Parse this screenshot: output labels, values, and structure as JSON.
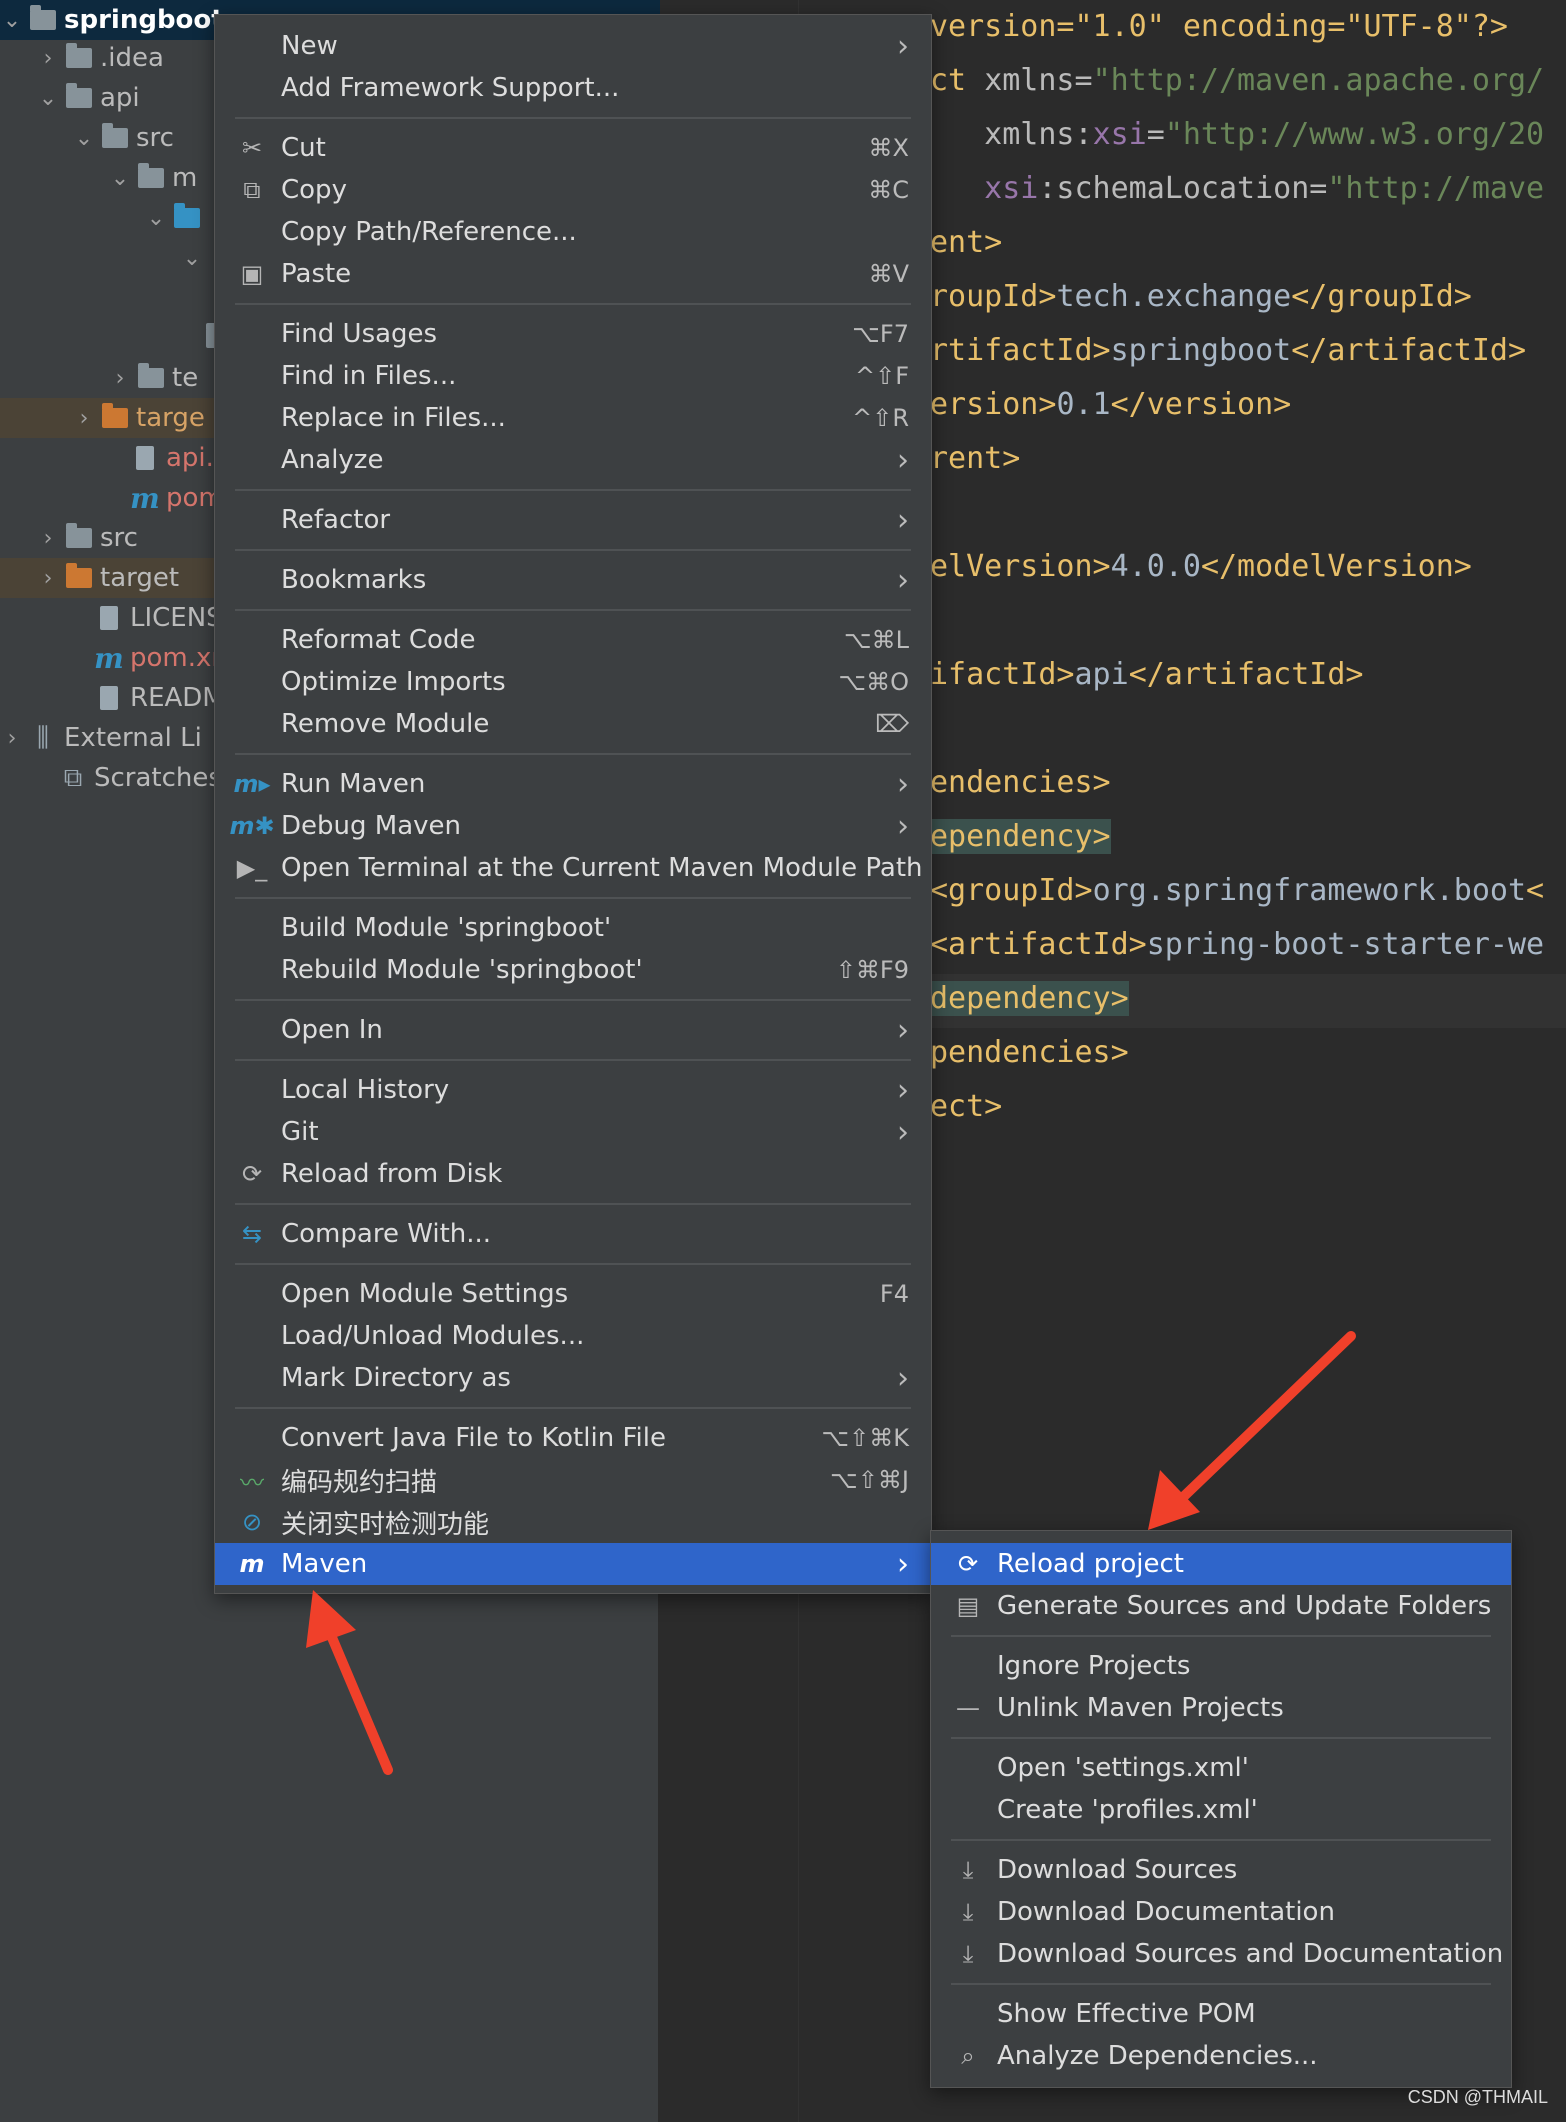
{
  "project_tree": {
    "rows": [
      {
        "label": "springboot",
        "chev": "⌄",
        "icon": "module-folder-icon"
      },
      {
        "label": ".idea",
        "chev": "›",
        "icon": "folder-icon"
      },
      {
        "label": "api",
        "chev": "⌄",
        "icon": "module-folder-icon"
      },
      {
        "label": "src",
        "chev": "⌄",
        "icon": "folder-icon"
      },
      {
        "label": "m",
        "chev": "⌄",
        "icon": "folder-icon"
      },
      {
        "label": "",
        "chev": "⌄",
        "icon": "blue-folder-icon"
      },
      {
        "label": "",
        "chev": "⌄",
        "icon": ""
      },
      {
        "label": "",
        "chev": "",
        "icon": "folder-icon"
      },
      {
        "label": "te",
        "chev": "›",
        "icon": "folder-icon"
      },
      {
        "label": "targe",
        "chev": "›",
        "icon": "orange-folder-icon"
      },
      {
        "label": "api.ir",
        "chev": "",
        "icon": "file-icon"
      },
      {
        "label": "pom.",
        "chev": "",
        "icon": "maven-icon"
      },
      {
        "label": "src",
        "chev": "›",
        "icon": "folder-icon"
      },
      {
        "label": "target",
        "chev": "›",
        "icon": "orange-folder-icon"
      },
      {
        "label": "LICENSE",
        "chev": "",
        "icon": "file-icon"
      },
      {
        "label": "pom.xm",
        "chev": "",
        "icon": "maven-icon"
      },
      {
        "label": "README",
        "chev": "",
        "icon": "file-icon"
      },
      {
        "label": "External Li",
        "chev": "›",
        "icon": "library-icon"
      },
      {
        "label": "Scratches a",
        "chev": "",
        "icon": "scratches-icon"
      }
    ]
  },
  "editor": {
    "lines": [
      {
        "parts": [
          [
            "pi",
            "version=\"1.0\" encoding=\"UTF-8\"?>"
          ]
        ]
      },
      {
        "parts": [
          [
            "tag",
            "ct "
          ],
          [
            "attr",
            "xmlns="
          ],
          [
            "val",
            "\"http://maven.apache.org/"
          ]
        ]
      },
      {
        "parts": [
          [
            "attr",
            "   xmlns:"
          ],
          [
            "ns",
            "xsi"
          ],
          [
            "attr",
            "="
          ],
          [
            "val",
            "\"http://www.w3.org/20"
          ]
        ]
      },
      {
        "parts": [
          [
            "ns",
            "   xsi"
          ],
          [
            "attr",
            ":schemaLocation="
          ],
          [
            "val",
            "\"http://mave"
          ]
        ]
      },
      {
        "parts": [
          [
            "tag",
            "ent>"
          ]
        ]
      },
      {
        "parts": [
          [
            "tag",
            "roupId>"
          ],
          [
            "text",
            "tech.exchange"
          ],
          [
            "tag",
            "</groupId>"
          ]
        ]
      },
      {
        "parts": [
          [
            "tag",
            "rtifactId>"
          ],
          [
            "text",
            "springboot"
          ],
          [
            "tag",
            "</artifactId>"
          ]
        ]
      },
      {
        "parts": [
          [
            "tag",
            "ersion>"
          ],
          [
            "text",
            "0.1"
          ],
          [
            "tag",
            "</version>"
          ]
        ]
      },
      {
        "parts": [
          [
            "tag",
            "rent>"
          ]
        ]
      },
      {
        "parts": []
      },
      {
        "parts": [
          [
            "tag",
            "elVersion>"
          ],
          [
            "text",
            "4.0.0"
          ],
          [
            "tag",
            "</modelVersion>"
          ]
        ]
      },
      {
        "parts": []
      },
      {
        "parts": [
          [
            "tag",
            "ifactId>"
          ],
          [
            "text",
            "api"
          ],
          [
            "tag",
            "</artifactId>"
          ]
        ]
      },
      {
        "parts": []
      },
      {
        "parts": [
          [
            "tag",
            "endencies>"
          ]
        ]
      },
      {
        "parts": [
          [
            "match",
            "ependency>"
          ]
        ]
      },
      {
        "parts": [
          [
            "tag",
            "<groupId>"
          ],
          [
            "text",
            "org.springframework.boot"
          ],
          [
            "tag",
            "<"
          ]
        ]
      },
      {
        "parts": [
          [
            "tag",
            "<artifactId>"
          ],
          [
            "text",
            "spring-boot-starter-we"
          ]
        ]
      },
      {
        "parts": [
          [
            "match",
            "dependency>"
          ]
        ]
      },
      {
        "parts": [
          [
            "tag",
            "pendencies>"
          ]
        ]
      },
      {
        "parts": [
          [
            "tag",
            "ect>"
          ]
        ]
      }
    ]
  },
  "context_menu": {
    "items": [
      {
        "label": "New",
        "shortcut": "",
        "submenu": true,
        "icon": ""
      },
      {
        "label": "Add Framework Support...",
        "shortcut": "",
        "submenu": false,
        "icon": ""
      },
      {
        "sep": true
      },
      {
        "label": "Cut",
        "shortcut": "⌘X",
        "submenu": false,
        "icon": "scissors-icon"
      },
      {
        "label": "Copy",
        "shortcut": "⌘C",
        "submenu": false,
        "icon": "copy-icon"
      },
      {
        "label": "Copy Path/Reference...",
        "shortcut": "",
        "submenu": false,
        "icon": ""
      },
      {
        "label": "Paste",
        "shortcut": "⌘V",
        "submenu": false,
        "icon": "paste-icon"
      },
      {
        "sep": true
      },
      {
        "label": "Find Usages",
        "shortcut": "⌥F7",
        "submenu": false,
        "icon": ""
      },
      {
        "label": "Find in Files...",
        "shortcut": "^⇧F",
        "submenu": false,
        "icon": ""
      },
      {
        "label": "Replace in Files...",
        "shortcut": "^⇧R",
        "submenu": false,
        "icon": ""
      },
      {
        "label": "Analyze",
        "shortcut": "",
        "submenu": true,
        "icon": ""
      },
      {
        "sep": true
      },
      {
        "label": "Refactor",
        "shortcut": "",
        "submenu": true,
        "icon": ""
      },
      {
        "sep": true
      },
      {
        "label": "Bookmarks",
        "shortcut": "",
        "submenu": true,
        "icon": ""
      },
      {
        "sep": true
      },
      {
        "label": "Reformat Code",
        "shortcut": "⌥⌘L",
        "submenu": false,
        "icon": ""
      },
      {
        "label": "Optimize Imports",
        "shortcut": "⌥⌘O",
        "submenu": false,
        "icon": ""
      },
      {
        "label": "Remove Module",
        "shortcut": "⌦",
        "submenu": false,
        "icon": ""
      },
      {
        "sep": true
      },
      {
        "label": "Run Maven",
        "shortcut": "",
        "submenu": true,
        "icon": "maven-run-icon"
      },
      {
        "label": "Debug Maven",
        "shortcut": "",
        "submenu": true,
        "icon": "maven-debug-icon"
      },
      {
        "label": "Open Terminal at the Current Maven Module Path",
        "shortcut": "",
        "submenu": false,
        "icon": "terminal-icon"
      },
      {
        "sep": true
      },
      {
        "label": "Build Module 'springboot'",
        "shortcut": "",
        "submenu": false,
        "icon": ""
      },
      {
        "label": "Rebuild Module 'springboot'",
        "shortcut": "⇧⌘F9",
        "submenu": false,
        "icon": ""
      },
      {
        "sep": true
      },
      {
        "label": "Open In",
        "shortcut": "",
        "submenu": true,
        "icon": ""
      },
      {
        "sep": true
      },
      {
        "label": "Local History",
        "shortcut": "",
        "submenu": true,
        "icon": ""
      },
      {
        "label": "Git",
        "shortcut": "",
        "submenu": true,
        "icon": ""
      },
      {
        "label": "Reload from Disk",
        "shortcut": "",
        "submenu": false,
        "icon": "reload-icon"
      },
      {
        "sep": true
      },
      {
        "label": "Compare With...",
        "shortcut": "",
        "submenu": false,
        "icon": "compare-icon"
      },
      {
        "sep": true
      },
      {
        "label": "Open Module Settings",
        "shortcut": "F4",
        "submenu": false,
        "icon": ""
      },
      {
        "label": "Load/Unload Modules...",
        "shortcut": "",
        "submenu": false,
        "icon": ""
      },
      {
        "label": "Mark Directory as",
        "shortcut": "",
        "submenu": true,
        "icon": ""
      },
      {
        "sep": true
      },
      {
        "label": "Convert Java File to Kotlin File",
        "shortcut": "⌥⇧⌘K",
        "submenu": false,
        "icon": ""
      },
      {
        "label": "编码规约扫描",
        "shortcut": "⌥⇧⌘J",
        "submenu": false,
        "icon": "scan-icon"
      },
      {
        "label": "关闭实时检测功能",
        "shortcut": "",
        "submenu": false,
        "icon": "disable-icon"
      },
      {
        "label": "Maven",
        "shortcut": "",
        "submenu": true,
        "icon": "maven-icon",
        "active": true
      }
    ]
  },
  "maven_submenu": {
    "items": [
      {
        "label": "Reload project",
        "icon": "reload-icon",
        "active": true
      },
      {
        "label": "Generate Sources and Update Folders",
        "icon": "generate-sources-icon"
      },
      {
        "sep": true
      },
      {
        "label": "Ignore Projects",
        "icon": ""
      },
      {
        "label": "Unlink Maven Projects",
        "icon": "minus-icon"
      },
      {
        "sep": true
      },
      {
        "label": "Open 'settings.xml'",
        "icon": ""
      },
      {
        "label": "Create 'profiles.xml'",
        "icon": ""
      },
      {
        "sep": true
      },
      {
        "label": "Download Sources",
        "icon": "download-icon"
      },
      {
        "label": "Download Documentation",
        "icon": "download-icon"
      },
      {
        "label": "Download Sources and Documentation",
        "icon": "download-icon"
      },
      {
        "sep": true
      },
      {
        "label": "Show Effective POM",
        "icon": ""
      },
      {
        "label": "Analyze Dependencies...",
        "icon": "search-icon"
      }
    ]
  },
  "colors": {
    "menu_bg": "#3c3f41",
    "highlight": "#2f65ca",
    "arrow": "#f0402a"
  },
  "watermark": "CSDN @THMAIL"
}
